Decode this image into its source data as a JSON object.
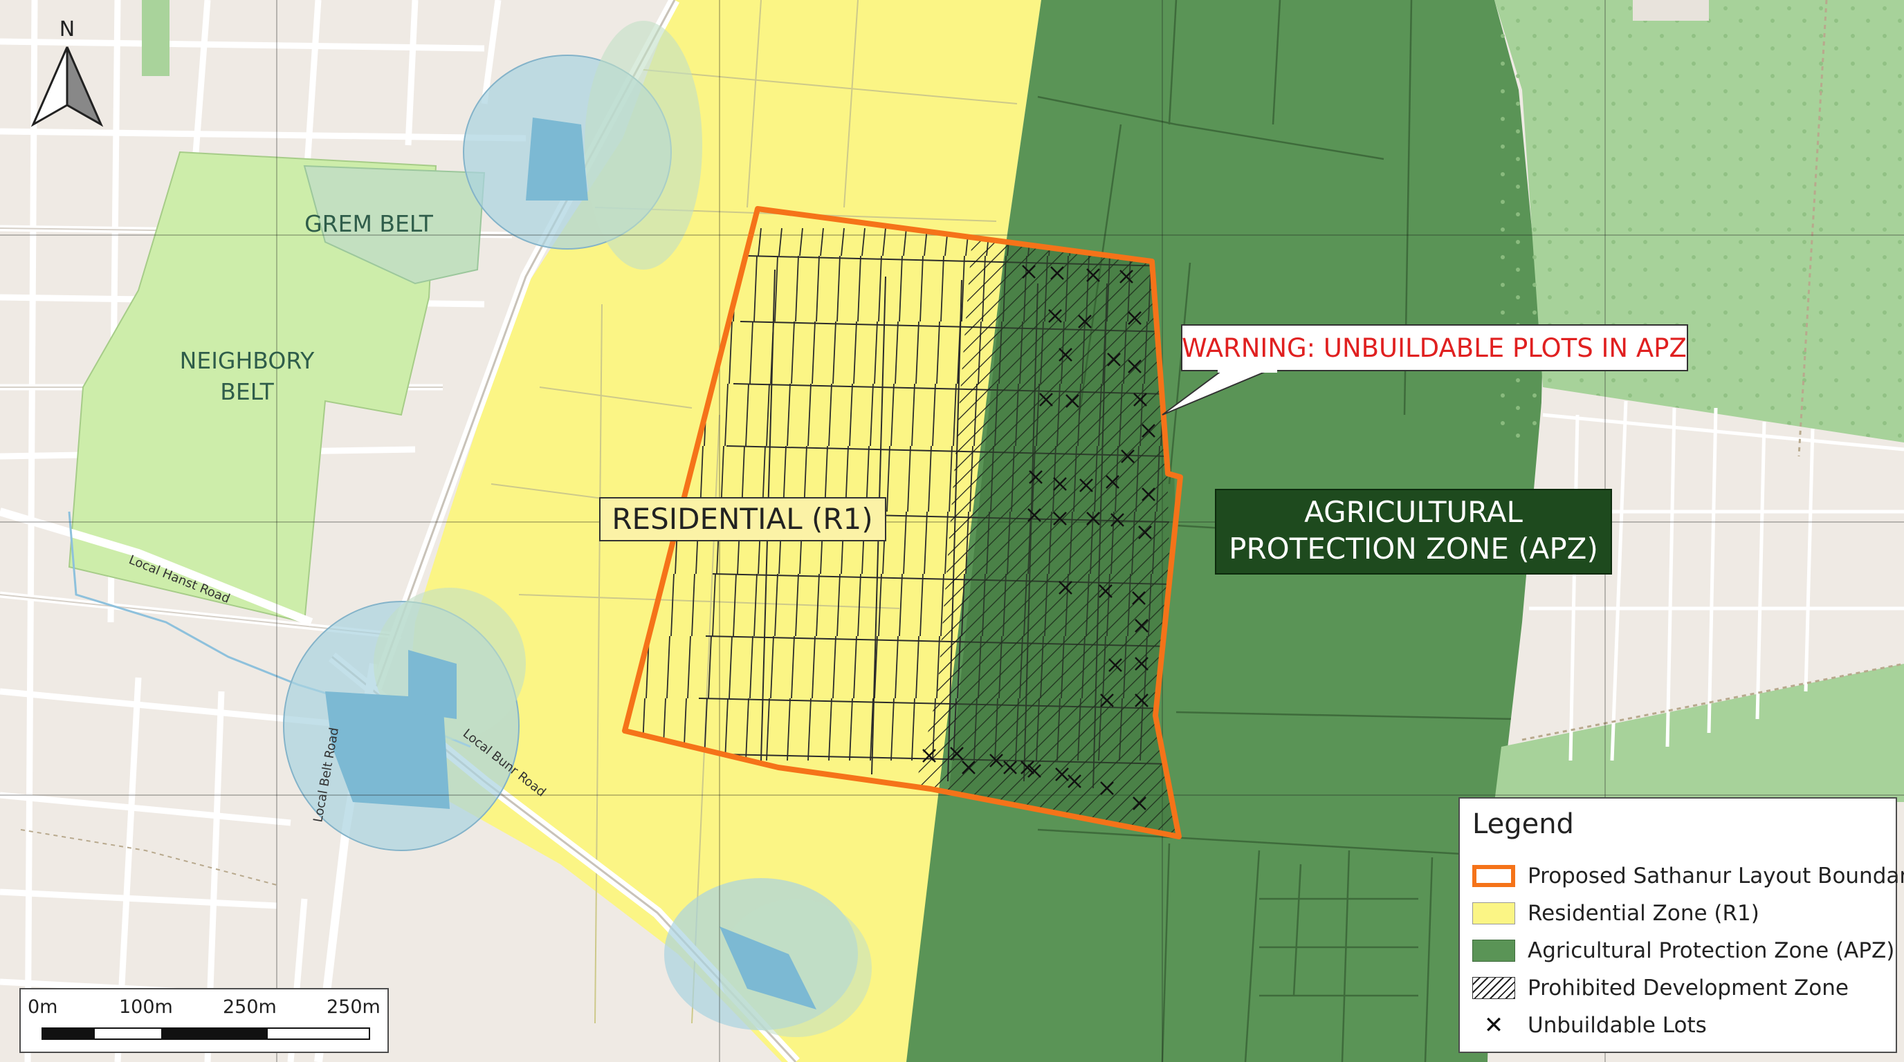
{
  "map": {
    "north_label": "N",
    "zone_labels": {
      "residential": "RESIDENTIAL (R1)",
      "apz_line1": "AGRICULTURAL",
      "apz_line2": "PROTECTION ZONE (APZ)",
      "grem_belt": "GREM BELT",
      "neighbory_line1": "NEIGHBORY",
      "neighbory_line2": "BELT"
    },
    "warning": "WARNING: UNBUILDABLE PLOTS IN APZ",
    "roads": {
      "hanst": "Local Hanst Road",
      "belt": "Local Belt Road",
      "bunr": "Local Bunr Road"
    },
    "colors": {
      "base": "#efeae4",
      "residential": "#fbf585",
      "apz": "#5a9456",
      "boundary": "#f57319",
      "park": "#cdedaa",
      "wood": "#a7d29a",
      "water": "#a9d3df",
      "warning_text": "#e02020",
      "apz_label_bg": "#1e4a1e"
    }
  },
  "legend": {
    "title": "Legend",
    "items": [
      {
        "label": "Proposed Sathanur Layout Boundary",
        "swatch": "boundary"
      },
      {
        "label": "Residential Zone (R1)",
        "swatch": "residential"
      },
      {
        "label": "Agricultural Protection Zone (APZ)",
        "swatch": "apz"
      },
      {
        "label": "Prohibited Development Zone",
        "swatch": "hatch"
      },
      {
        "label": "Unbuildable Lots",
        "swatch": "cross"
      }
    ]
  },
  "scale": {
    "labels": [
      "0m",
      "100m",
      "250m",
      "250m"
    ]
  }
}
